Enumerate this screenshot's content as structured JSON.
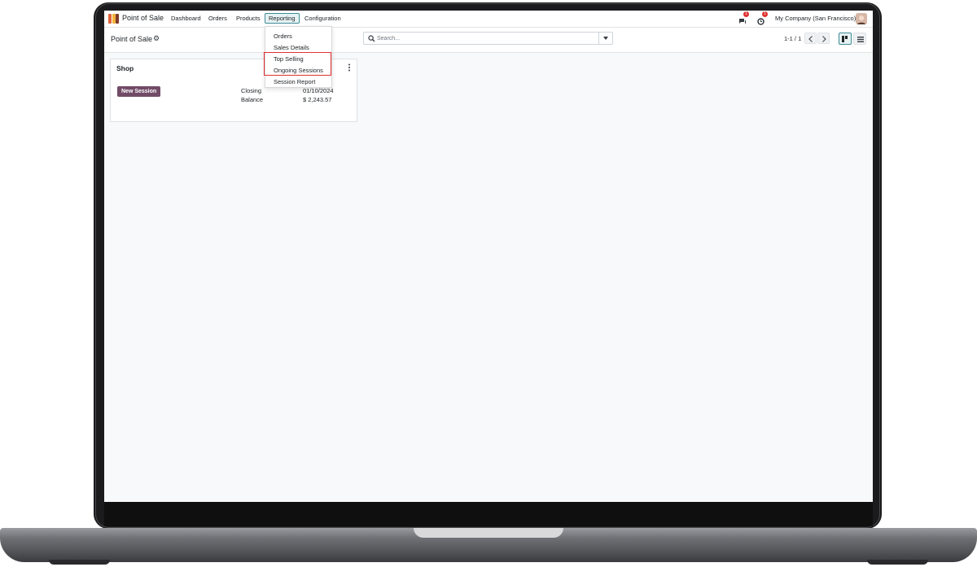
{
  "navbar": {
    "brand": "Point of Sale",
    "menus": [
      "Dashboard",
      "Orders",
      "Products",
      "Reporting",
      "Configuration"
    ],
    "active_menu": "Reporting",
    "messages_badge": "1",
    "activities_badge": "1",
    "company": "My Company (San Francisco)"
  },
  "control_panel": {
    "breadcrumb": "Point of Sale",
    "search_placeholder": "Search...",
    "pager": "1-1 / 1"
  },
  "reporting_menu": {
    "items": [
      "Orders",
      "Sales Details",
      "Top Selling",
      "Ongoing Sessions",
      "Session Report"
    ],
    "highlighted": [
      "Top Selling",
      "Ongoing Sessions"
    ]
  },
  "card": {
    "title": "Shop",
    "button": "New Session",
    "closing_label": "Closing",
    "closing_value": "01/10/2024",
    "balance_label": "Balance",
    "balance_value": "$ 2,243.57"
  },
  "colors": {
    "primary": "#714b67",
    "accent": "#3f8b96",
    "highlight": "#e03131"
  },
  "icons": [
    "app-logo-icon",
    "gear-icon",
    "search-icon",
    "caret-down-icon",
    "chevron-left-icon",
    "chevron-right-icon",
    "kanban-view-icon",
    "list-view-icon",
    "messages-icon",
    "activities-icon",
    "kebab-menu-icon"
  ]
}
